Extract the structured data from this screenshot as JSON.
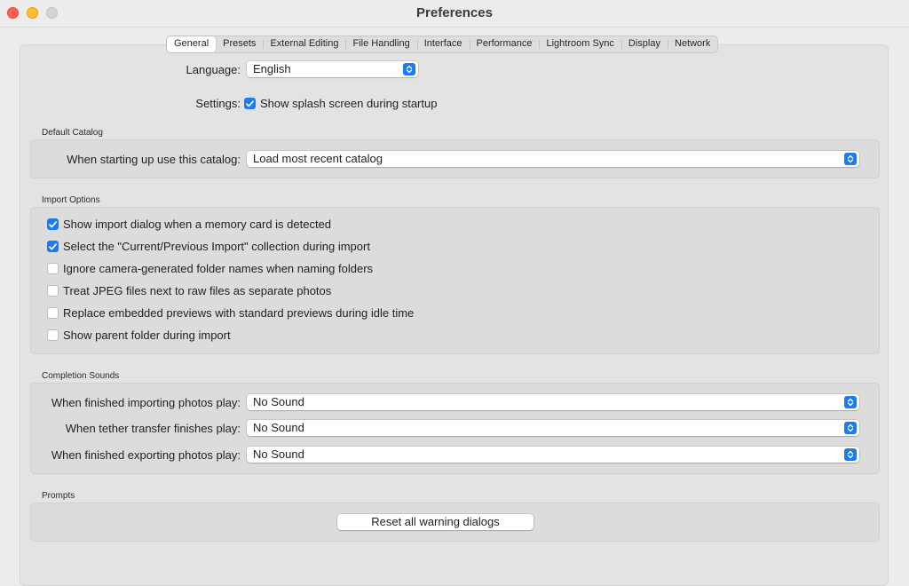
{
  "window": {
    "title": "Preferences"
  },
  "tabs": [
    {
      "label": "General",
      "active": true
    },
    {
      "label": "Presets",
      "active": false
    },
    {
      "label": "External Editing",
      "active": false
    },
    {
      "label": "File Handling",
      "active": false
    },
    {
      "label": "Interface",
      "active": false
    },
    {
      "label": "Performance",
      "active": false
    },
    {
      "label": "Lightroom Sync",
      "active": false
    },
    {
      "label": "Display",
      "active": false
    },
    {
      "label": "Network",
      "active": false
    }
  ],
  "general": {
    "language_label": "Language:",
    "language_value": "English",
    "settings_label": "Settings:",
    "splash": {
      "label": "Show splash screen during startup",
      "checked": true
    }
  },
  "default_catalog": {
    "title": "Default Catalog",
    "label": "When starting up use this catalog:",
    "value": "Load most recent catalog"
  },
  "import_options": {
    "title": "Import Options",
    "items": [
      {
        "label": "Show import dialog when a memory card is detected",
        "checked": true
      },
      {
        "label": "Select the \"Current/Previous Import\" collection during import",
        "checked": true
      },
      {
        "label": "Ignore camera-generated folder names when naming folders",
        "checked": false
      },
      {
        "label": "Treat JPEG files next to raw files as separate photos",
        "checked": false
      },
      {
        "label": "Replace embedded previews with standard previews during idle time",
        "checked": false
      },
      {
        "label": "Show parent folder during import",
        "checked": false
      }
    ]
  },
  "completion_sounds": {
    "title": "Completion Sounds",
    "rows": [
      {
        "label": "When finished importing photos play:",
        "value": "No Sound"
      },
      {
        "label": "When tether transfer finishes play:",
        "value": "No Sound"
      },
      {
        "label": "When finished exporting photos play:",
        "value": "No Sound"
      }
    ]
  },
  "prompts": {
    "title": "Prompts",
    "reset_label": "Reset all warning dialogs"
  },
  "colors": {
    "accent": "#1a7bf5",
    "close": "#fe5f57",
    "minimize": "#febc2e",
    "zoom": "#d4d4d4"
  }
}
